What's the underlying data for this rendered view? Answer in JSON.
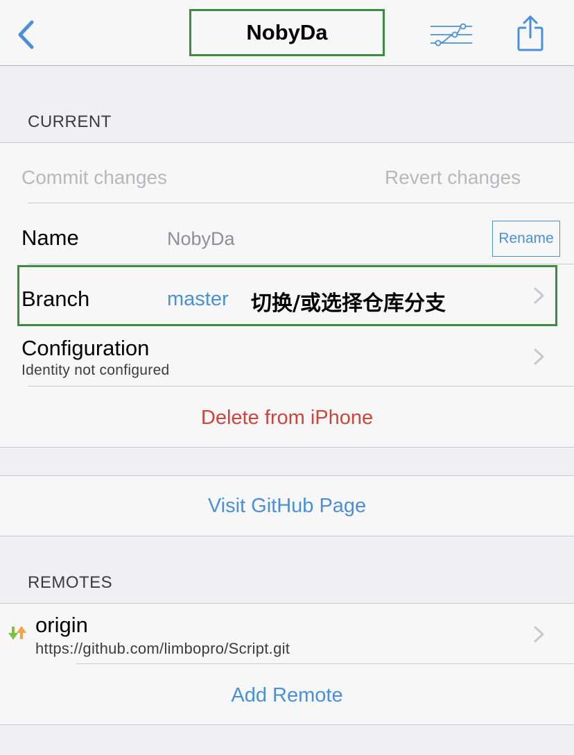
{
  "nav": {
    "title": "NobyDa",
    "back_icon": "chevron-left-icon",
    "branches_icon": "git-branches-icon",
    "share_icon": "share-icon"
  },
  "current": {
    "header": "CURRENT",
    "commit_label": "Commit changes",
    "revert_label": "Revert changes",
    "name_label": "Name",
    "name_value": "NobyDa",
    "rename_label": "Rename",
    "branch_label": "Branch",
    "branch_value": "master",
    "branch_annotation": "切换/或选择仓库分支",
    "config_label": "Configuration",
    "config_sub": "Identity not configured",
    "delete_label": "Delete from iPhone"
  },
  "github": {
    "visit_label": "Visit GitHub Page"
  },
  "remotes": {
    "header": "REMOTES",
    "items": [
      {
        "name": "origin",
        "url": "https://github.com/limbopro/Script.git",
        "icon": "push-pull-arrows-icon"
      }
    ],
    "add_label": "Add Remote"
  },
  "colors": {
    "accent": "#4a90d9",
    "destructive": "#d0433b",
    "annotation": "#3a8d3e",
    "background": "#efeff4"
  }
}
